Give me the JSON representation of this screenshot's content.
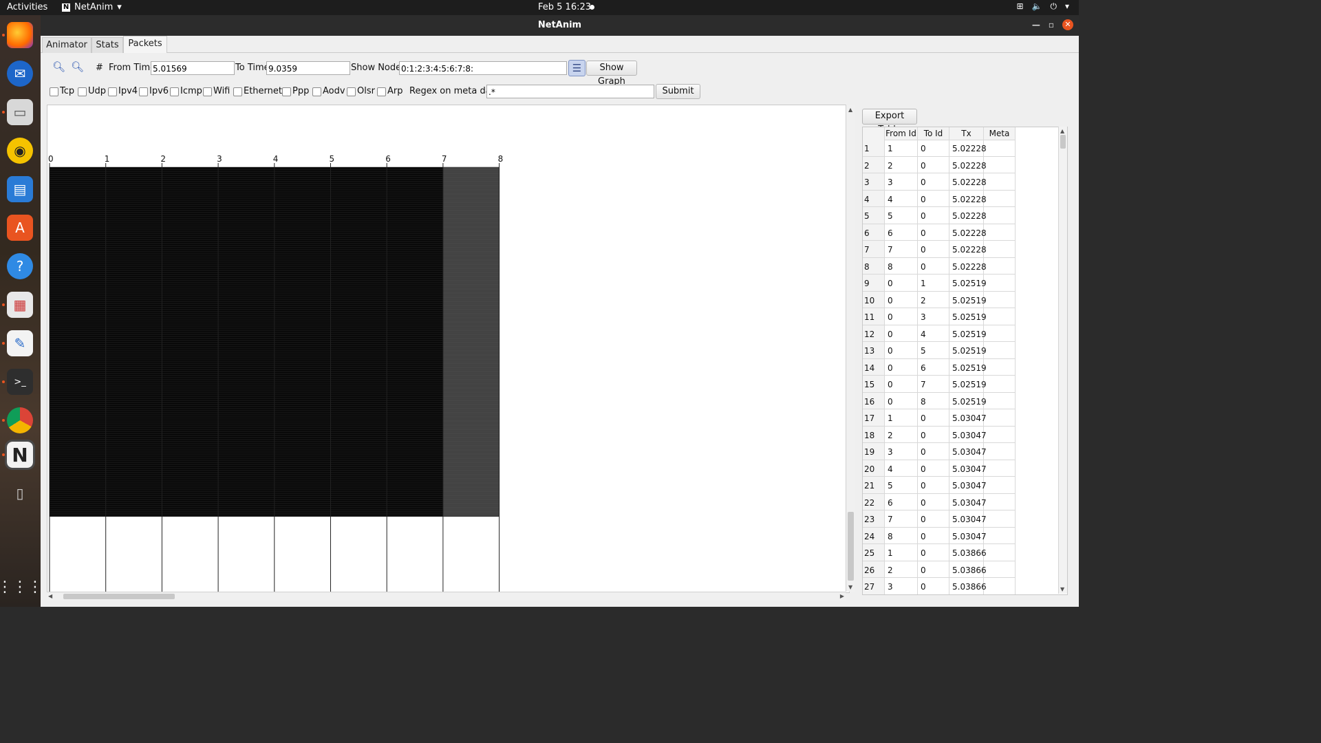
{
  "topbar": {
    "activities": "Activities",
    "app_name": "NetAnim",
    "clock": "Feb 5  16:23"
  },
  "window": {
    "title": "NetAnim"
  },
  "tabs": [
    {
      "label": "Animator"
    },
    {
      "label": "Stats"
    },
    {
      "label": "Packets"
    }
  ],
  "filters": {
    "from_time_label": "From Time",
    "from_time_value": "5.01569",
    "to_time_label": "To Time",
    "to_time_value": "9.0359",
    "show_nodes_label": "Show Nodes",
    "show_nodes_value": "0:1:2:3:4:5:6:7:8:",
    "show_graph_label": "Show Graph",
    "protocols": [
      "Tcp",
      "Udp",
      "Ipv4",
      "Ipv6",
      "Icmp",
      "Wifi",
      "Ethernet",
      "Ppp",
      "Aodv",
      "Olsr",
      "Arp"
    ],
    "regex_label": "Regex on meta data",
    "regex_value": ".*",
    "submit_label": "Submit"
  },
  "graph": {
    "node_labels": [
      "0",
      "1",
      "2",
      "3",
      "4",
      "5",
      "6",
      "7",
      "8"
    ]
  },
  "packet_table": {
    "export_label": "Export Table",
    "columns": [
      "From Id",
      "To Id",
      "Tx",
      "Meta"
    ],
    "rows": [
      [
        "1",
        "1",
        "0",
        "5.02228",
        ""
      ],
      [
        "2",
        "2",
        "0",
        "5.02228",
        ""
      ],
      [
        "3",
        "3",
        "0",
        "5.02228",
        ""
      ],
      [
        "4",
        "4",
        "0",
        "5.02228",
        ""
      ],
      [
        "5",
        "5",
        "0",
        "5.02228",
        ""
      ],
      [
        "6",
        "6",
        "0",
        "5.02228",
        ""
      ],
      [
        "7",
        "7",
        "0",
        "5.02228",
        ""
      ],
      [
        "8",
        "8",
        "0",
        "5.02228",
        ""
      ],
      [
        "9",
        "0",
        "1",
        "5.02519",
        ""
      ],
      [
        "10",
        "0",
        "2",
        "5.02519",
        ""
      ],
      [
        "11",
        "0",
        "3",
        "5.02519",
        ""
      ],
      [
        "12",
        "0",
        "4",
        "5.02519",
        ""
      ],
      [
        "13",
        "0",
        "5",
        "5.02519",
        ""
      ],
      [
        "14",
        "0",
        "6",
        "5.02519",
        ""
      ],
      [
        "15",
        "0",
        "7",
        "5.02519",
        ""
      ],
      [
        "16",
        "0",
        "8",
        "5.02519",
        ""
      ],
      [
        "17",
        "1",
        "0",
        "5.03047",
        ""
      ],
      [
        "18",
        "2",
        "0",
        "5.03047",
        ""
      ],
      [
        "19",
        "3",
        "0",
        "5.03047",
        ""
      ],
      [
        "20",
        "4",
        "0",
        "5.03047",
        ""
      ],
      [
        "21",
        "5",
        "0",
        "5.03047",
        ""
      ],
      [
        "22",
        "6",
        "0",
        "5.03047",
        ""
      ],
      [
        "23",
        "7",
        "0",
        "5.03047",
        ""
      ],
      [
        "24",
        "8",
        "0",
        "5.03047",
        ""
      ],
      [
        "25",
        "1",
        "0",
        "5.03866",
        ""
      ],
      [
        "26",
        "2",
        "0",
        "5.03866",
        ""
      ],
      [
        "27",
        "3",
        "0",
        "5.03866",
        ""
      ]
    ]
  },
  "dock": {
    "items": [
      "firefox-icon",
      "thunderbird-icon",
      "files-icon",
      "rhythmbox-icon",
      "writer-icon",
      "app-center-icon",
      "help-icon",
      "impress-icon",
      "text-editor-icon",
      "terminal-icon",
      "chrome-icon",
      "netanim-icon",
      "usb-drive-icon",
      "app-grid-icon"
    ]
  }
}
